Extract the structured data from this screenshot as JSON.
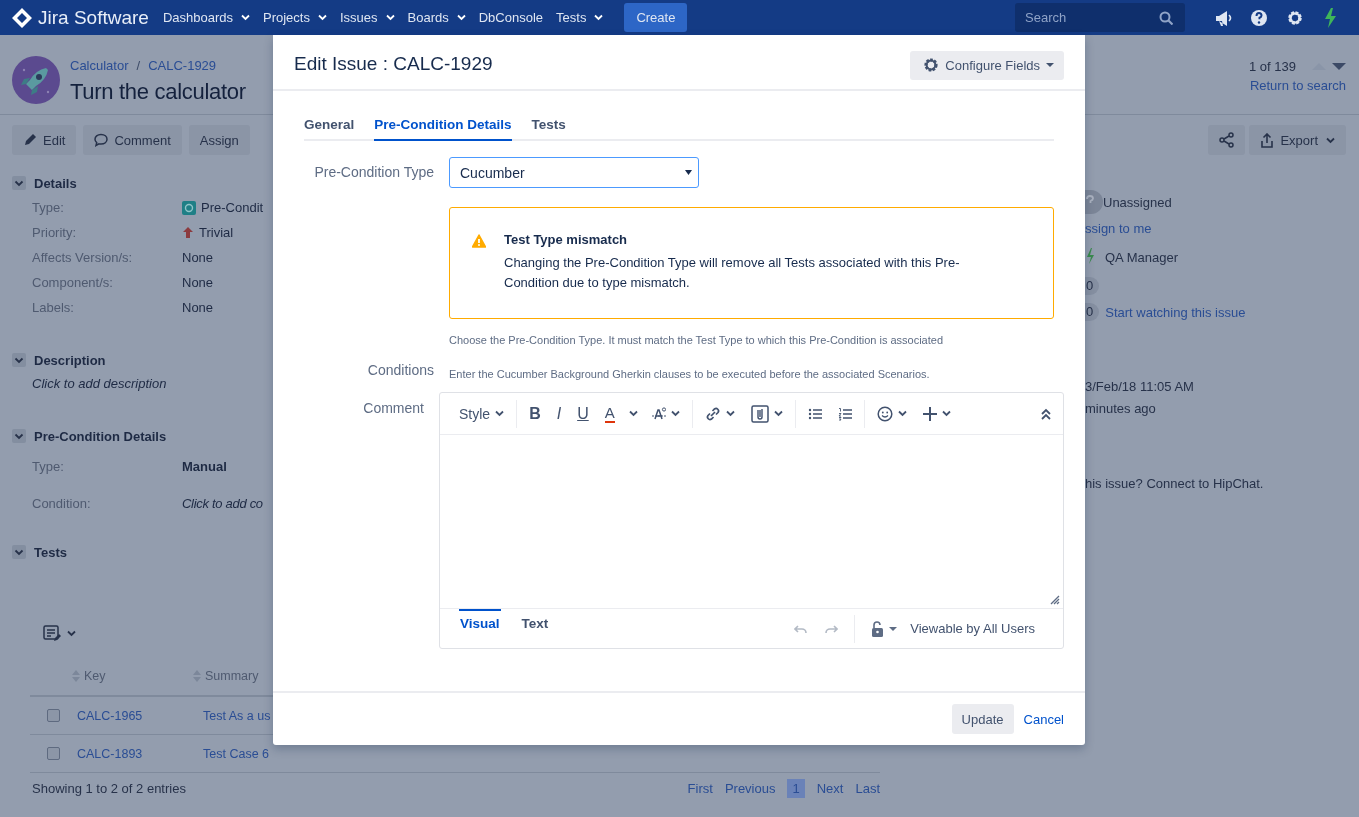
{
  "top_nav": {
    "logo": "Jira Software",
    "items": [
      {
        "label": "Dashboards",
        "dropdown": true
      },
      {
        "label": "Projects",
        "dropdown": true
      },
      {
        "label": "Issues",
        "dropdown": true
      },
      {
        "label": "Boards",
        "dropdown": true
      },
      {
        "label": "DbConsole",
        "dropdown": false
      },
      {
        "label": "Tests",
        "dropdown": true
      }
    ],
    "create": "Create",
    "search": {
      "placeholder": "Search"
    }
  },
  "issue_header": {
    "breadcrumbs": [
      "Calculator",
      "CALC-1929"
    ],
    "breadcrumb_separator": "/",
    "title": "Turn the calculator",
    "pager": "1 of 139",
    "return_link": "Return to search"
  },
  "toolbar": {
    "buttons": [
      {
        "label": "Edit",
        "kind": "edit"
      },
      {
        "label": "Comment",
        "kind": "comment"
      },
      {
        "label": "Assign",
        "kind": "plain"
      }
    ],
    "export": "Export"
  },
  "details": {
    "heading": "Details",
    "fields": [
      {
        "label": "Type:",
        "value": "Pre-Condit",
        "kind": "issue-type"
      },
      {
        "label": "Priority:",
        "value": "Trivial",
        "kind": "priority"
      },
      {
        "label": "Affects Version/s:",
        "value": "None",
        "kind": "plain"
      },
      {
        "label": "Component/s:",
        "value": "None",
        "kind": "plain"
      },
      {
        "label": "Labels:",
        "value": "None",
        "kind": "plain"
      }
    ]
  },
  "description": {
    "heading": "Description",
    "prompt": "Click to add description"
  },
  "precondition_details": {
    "heading": "Pre-Condition Details",
    "fields": [
      {
        "label": "Type:",
        "value": "Manual",
        "kind": "strong"
      },
      {
        "label": "Condition:",
        "value": "Click to add co",
        "kind": "prompt"
      }
    ]
  },
  "people": [
    {
      "kind": "unassigned",
      "text": "Unassigned"
    },
    {
      "kind": "link",
      "text": "ssign to me"
    },
    {
      "kind": "reporter",
      "text": "QA Manager"
    },
    {
      "kind": "badge",
      "badge": "0"
    },
    {
      "kind": "badge",
      "badge": "0",
      "text": "Start watching this issue"
    }
  ],
  "dates": [
    "3/Feb/18 11:05 AM",
    "minutes ago"
  ],
  "hipchat": "his issue? Connect to HipChat.",
  "tests": {
    "heading": "Tests",
    "columns": [
      "Key",
      "Summary"
    ],
    "rows": [
      {
        "checked": false,
        "key": "CALC-1965",
        "summary": "Test As a us"
      },
      {
        "checked": false,
        "key": "CALC-1893",
        "summary": "Test Case 6"
      }
    ],
    "footer": "Showing 1 to 2 of 2 entries",
    "pagination": [
      {
        "label": "First",
        "selected": false
      },
      {
        "label": "Previous",
        "selected": false
      },
      {
        "label": "1",
        "selected": true
      },
      {
        "label": "Next",
        "selected": false
      },
      {
        "label": "Last",
        "selected": false
      }
    ]
  },
  "modal": {
    "title": "Edit Issue : CALC-1929",
    "configure_button": "Configure Fields",
    "tabs": [
      {
        "label": "General",
        "selected": false
      },
      {
        "label": "Pre-Condition Details",
        "selected": true
      },
      {
        "label": "Tests",
        "selected": false
      }
    ],
    "precondition_type": {
      "label": "Pre-Condition Type",
      "value": "Cucumber"
    },
    "warning": {
      "title": "Test Type mismatch",
      "text": "Changing the Pre-Condition Type will remove all Tests associated with this Pre-Condition due to type mismatch."
    },
    "type_hint": "Choose the Pre-Condition Type. It must match the Test Type to which this Pre-Condition is associated",
    "conditions": {
      "label": "Conditions",
      "hint": "Enter the Cucumber Background Gherkin clauses to be executed before the associated Scenarios."
    },
    "comment": {
      "label": "Comment",
      "tools": [
        {
          "kind": "style",
          "label": "Style"
        },
        {
          "kind": "bold",
          "label": "B"
        },
        {
          "kind": "italic",
          "label": "I"
        },
        {
          "kind": "underline",
          "label": "U"
        },
        {
          "kind": "color",
          "label": "A"
        },
        {
          "kind": "format"
        },
        {
          "kind": "link"
        },
        {
          "kind": "attach"
        },
        {
          "kind": "bullets"
        },
        {
          "kind": "numbers"
        },
        {
          "kind": "emoji"
        },
        {
          "kind": "insert"
        },
        {
          "kind": "collapse"
        }
      ],
      "editor_tabs": [
        {
          "label": "Visual",
          "selected": true
        },
        {
          "label": "Text",
          "selected": false
        }
      ],
      "history": [
        {
          "kind": "undo",
          "disabled": true
        },
        {
          "kind": "redo",
          "disabled": true
        }
      ],
      "visibility": "Viewable by All Users"
    },
    "update": "Update",
    "cancel": "Cancel"
  }
}
